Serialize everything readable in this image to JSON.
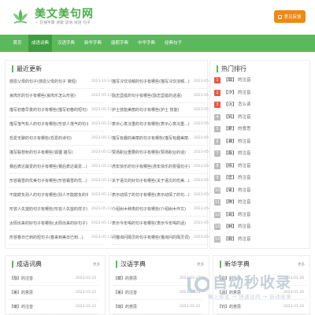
{
  "header": {
    "site_title": "美文美句网",
    "slogan": "— 在线字典 诗歌 谚语 谜语 句子",
    "feedback_label": "意见反馈"
  },
  "nav": {
    "items": [
      {
        "label": "首页"
      },
      {
        "label": "成语词典"
      },
      {
        "label": "汉语字典"
      },
      {
        "label": "新华字典"
      },
      {
        "label": "康熙字典"
      },
      {
        "label": "中华字典"
      },
      {
        "label": "经典句子"
      }
    ],
    "active_index": 1
  },
  "latest": {
    "title": "最近更新",
    "left": [
      {
        "title": "感恩父母的句子(感恩父母的句子 简短)",
        "date": "2023-10-14"
      },
      {
        "title": "良肉乐的句子有哪些(良肉乐怎么形容)",
        "date": "2023-05-12"
      },
      {
        "title": "描写初春早景的句子有哪些(描写初春的短句)",
        "date": "2023-05-12"
      },
      {
        "title": "描写落气松人的句子有哪些(形容人落气的句子)",
        "date": "2023-05-12"
      },
      {
        "title": "恐爱无聊的句子有哪些(恐爱的诗句)",
        "date": "2023-05-12"
      },
      {
        "title": "描写联想秋的句子有哪些(狐狸 描写)",
        "date": "2023-05-12"
      },
      {
        "title": "赛后表达最爱的句子有哪些(赛后表达最爱...)",
        "date": "2023-05-12"
      },
      {
        "title": "形容霜雪的优美句子有哪些(形容霜雪的优...)",
        "date": "2023-05-12"
      },
      {
        "title": "不能欺负别人的句子有哪些(别人不能欺负的句子)",
        "date": "2023-05-12"
      },
      {
        "title": "形容人失望的句子有哪些(形容人失望的样子)",
        "date": "2023-05-12"
      },
      {
        "title": "太阳出来的好句子有哪些(太阳出来的好句子)",
        "date": "2023-05-12"
      },
      {
        "title": "形容春日已到的短句子(春来到美日已到...)",
        "date": "2023-05-12"
      }
    ],
    "right": [
      {
        "title": "描写冷饮浓郁的句子有哪些(描写冷饮浓郁...)",
        "date": "2023-05-12"
      },
      {
        "title": "励志坚挺的句子有哪些(励志坚挺的话语)",
        "date": "2023-05-12"
      },
      {
        "title": "护士技能美丽的句子有哪些(护士 技能)",
        "date": "2023-05-12"
      },
      {
        "title": "表示心意沉重的句子有哪些(表示心意沉重...)",
        "date": "2023-05-12"
      },
      {
        "title": "描写有趣的美丽的句子有哪些(描写有趣美丽...)",
        "date": "2023-05-12"
      },
      {
        "title": "赞扬职业重要的句子有哪些(赞扬职业的话)",
        "date": "2023-05-12"
      },
      {
        "title": "虎年快乐的句子有哪些(虎年快乐的祝福句子)",
        "date": "2023-05-12"
      },
      {
        "title": "关于语文的好句子有哪些(关于语文的优美...)",
        "date": "2023-05-12"
      },
      {
        "title": "表示动情了的句子有哪些(表示动情了的句...)",
        "date": "2023-05-12"
      },
      {
        "title": "介绍树木种类的句子有哪些(介绍树木作文)",
        "date": "2023-05-12"
      },
      {
        "title": "表示今年喝的句子有哪些(表示今年喝的话)",
        "date": "2023-05-12"
      },
      {
        "title": "问猫询问隔灵的句子有哪些(猫询问的隔灵词)",
        "date": "2023-05-12"
      }
    ]
  },
  "hot": {
    "title": "热门排行",
    "items": [
      {
        "num": "1",
        "char": "【戬】",
        "text": "的注音"
      },
      {
        "num": "2",
        "char": "【汐】",
        "text": "的注音"
      },
      {
        "num": "3",
        "char": "【沉】",
        "text": "怎么读"
      },
      {
        "num": "4",
        "char": "【鸫】",
        "text": "的注音"
      },
      {
        "num": "5",
        "char": "【薪】",
        "text": "的意思"
      },
      {
        "num": "6",
        "char": "【濑】",
        "text": "的注音"
      },
      {
        "num": "7",
        "char": "【蕤】",
        "text": "的注音"
      },
      {
        "num": "8",
        "char": "【捺】",
        "text": "的注音"
      },
      {
        "num": "9",
        "char": "【宦】",
        "text": "的注音"
      },
      {
        "num": "10",
        "char": "【旻】",
        "text": "的注音"
      },
      {
        "num": "11",
        "char": "【翀】",
        "text": "的注音"
      },
      {
        "num": "12",
        "char": "【阆】",
        "text": "的注音"
      },
      {
        "num": "13",
        "char": "【娴】",
        "text": "的注音"
      },
      {
        "num": "14",
        "char": "【靓】",
        "text": "的注音"
      }
    ]
  },
  "bottom": {
    "more_label": "更多",
    "idiom": {
      "title": "成语词典",
      "rows": [
        {
          "word": "【戬】的注音",
          "date": "2023-01-23"
        },
        {
          "word": "【薰】的意思",
          "date": "2023-01-23"
        },
        {
          "word": "【曦】的注音",
          "date": "2023-01-23"
        }
      ]
    },
    "hanyu": {
      "title": "汉语字典",
      "rows": [
        {
          "word": "【藏】的意思",
          "date": "2023-01-23"
        },
        {
          "word": "【薰】的注音",
          "date": "2023-01-23"
        },
        {
          "word": "【璐】的意思",
          "date": "2023-01-23"
        }
      ]
    },
    "xinhua": {
      "title": "新华字典",
      "rows": [
        {
          "word": "【鑫】的注音",
          "date": "2023-01-26"
        },
        {
          "word": "【涵】的意思",
          "date": "2023-01-26"
        },
        {
          "word": "【钧】的意思",
          "date": "2023-01-26"
        }
      ]
    }
  },
  "watermark": {
    "title": "自动秒收录",
    "sub": "做上排名 → 快速访问 → 自动收录"
  },
  "colors": {
    "accent": "#5cb85c",
    "nav_active": "#3f9e3f",
    "feedback": "#f0890f",
    "hot_top": "#e9573f"
  }
}
